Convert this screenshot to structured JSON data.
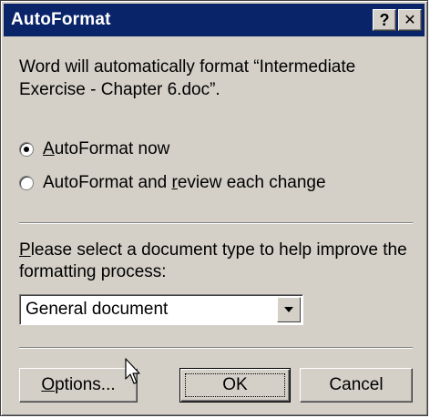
{
  "dialog": {
    "title": "AutoFormat",
    "help_button": "?",
    "close_button": "✕",
    "message": "Word will automatically format “Intermediate Exercise - Chapter 6.doc”.",
    "options": [
      {
        "label_pre": "",
        "label_u": "A",
        "label_post": "utoFormat now",
        "checked": true
      },
      {
        "label_pre": "AutoFormat and ",
        "label_u": "r",
        "label_post": "eview each change",
        "checked": false
      }
    ],
    "doc_type_prompt_u": "P",
    "doc_type_prompt_rest": "lease select a document type to help improve the formatting process:",
    "doc_type_selected": "General document",
    "buttons": {
      "options_u": "O",
      "options_rest": "ptions...",
      "ok": "OK",
      "cancel": "Cancel"
    }
  },
  "colors": {
    "titlebar": "#0a246a",
    "face": "#d4d0c8"
  }
}
